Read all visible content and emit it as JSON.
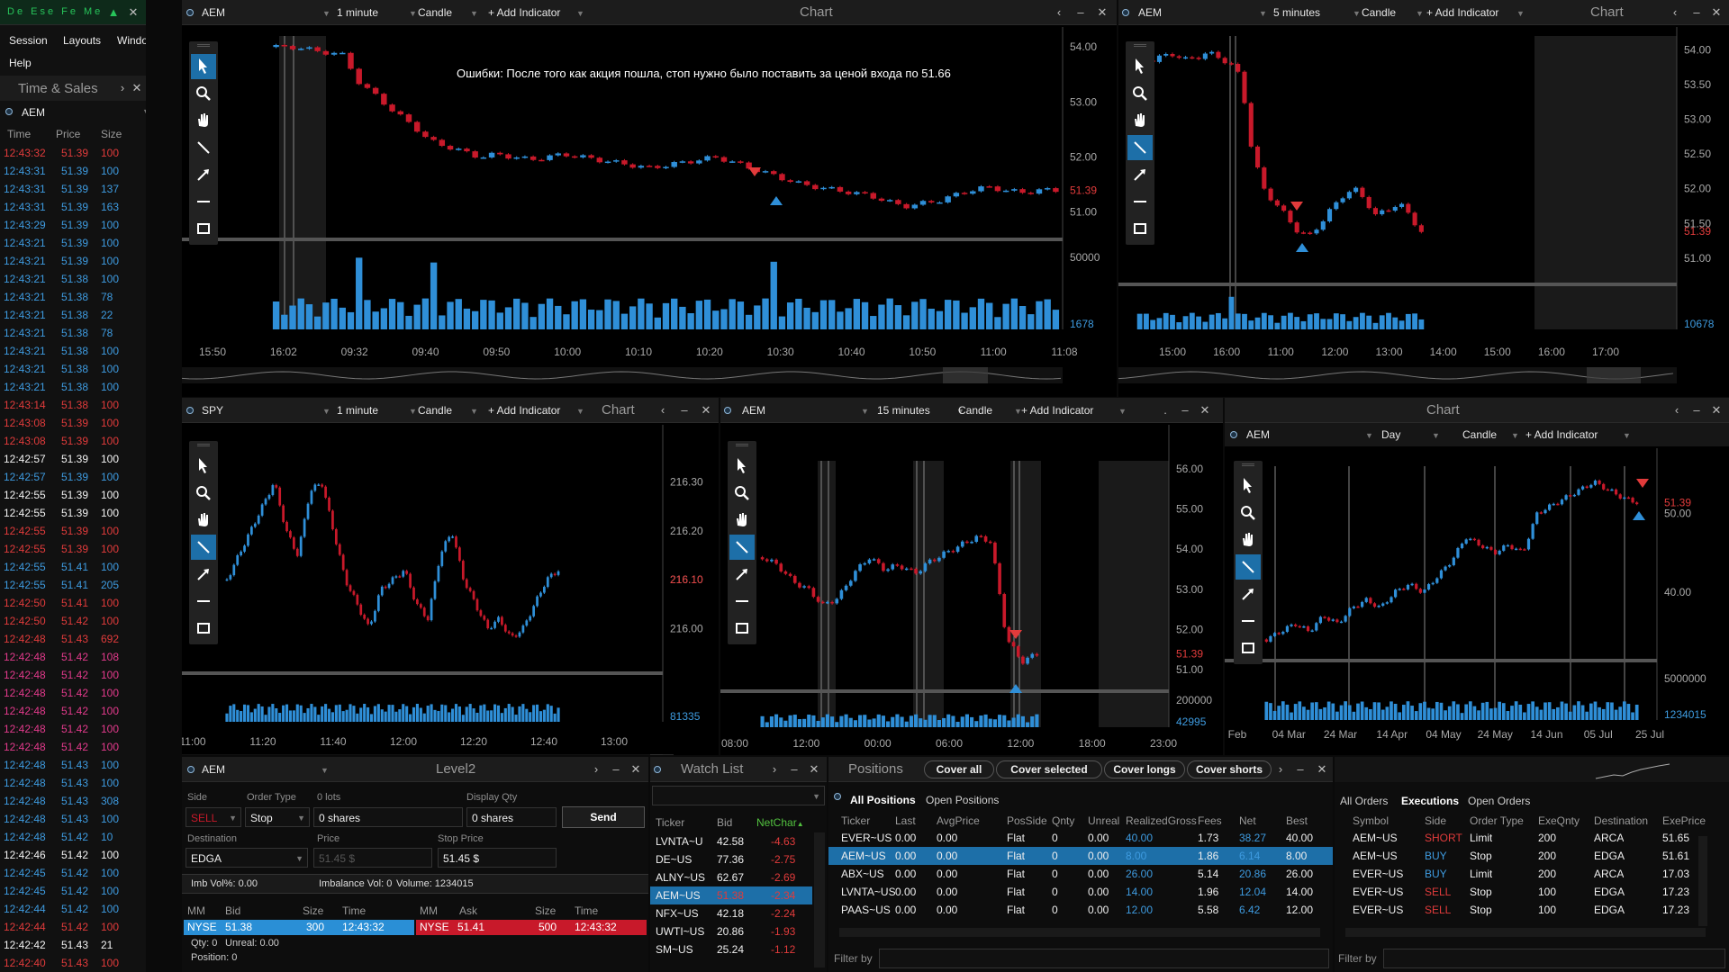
{
  "app": {
    "logo": "De Ese Fe Me"
  },
  "menu": {
    "session": "Session",
    "layouts": "Layouts",
    "windows": "Windows",
    "help": "Help"
  },
  "colors": {
    "up": "#2f8fd8",
    "down": "#c8192a",
    "accent": "#1d6fa8",
    "panel": "#000000",
    "bar": "#1c1c1c"
  },
  "icons": {
    "pointer": "pointer-icon",
    "zoom": "magnifier-icon",
    "pan": "hand-icon",
    "line": "line-tool-icon",
    "arrow": "arrow-tool-icon",
    "hline": "horizontal-line-icon",
    "rect": "rectangle-icon"
  },
  "ts": {
    "title": "Time & Sales",
    "symbol": "AEM",
    "headers": [
      "Time",
      "Price",
      "Size"
    ],
    "rows": [
      [
        "12:43:32",
        "51.39",
        "100",
        "r"
      ],
      [
        "12:43:31",
        "51.39",
        "100",
        "b"
      ],
      [
        "12:43:31",
        "51.39",
        "137",
        "b"
      ],
      [
        "12:43:31",
        "51.39",
        "163",
        "b"
      ],
      [
        "12:43:29",
        "51.39",
        "100",
        "b"
      ],
      [
        "12:43:21",
        "51.39",
        "100",
        "b"
      ],
      [
        "12:43:21",
        "51.39",
        "100",
        "b"
      ],
      [
        "12:43:21",
        "51.38",
        "100",
        "b"
      ],
      [
        "12:43:21",
        "51.38",
        "78",
        "b"
      ],
      [
        "12:43:21",
        "51.38",
        "22",
        "b"
      ],
      [
        "12:43:21",
        "51.38",
        "78",
        "b"
      ],
      [
        "12:43:21",
        "51.38",
        "100",
        "b"
      ],
      [
        "12:43:21",
        "51.38",
        "100",
        "b"
      ],
      [
        "12:43:21",
        "51.38",
        "100",
        "b"
      ],
      [
        "12:43:14",
        "51.38",
        "100",
        "r"
      ],
      [
        "12:43:08",
        "51.39",
        "100",
        "r"
      ],
      [
        "12:43:08",
        "51.39",
        "100",
        "r"
      ],
      [
        "12:42:57",
        "51.39",
        "100",
        "w"
      ],
      [
        "12:42:57",
        "51.39",
        "100",
        "b"
      ],
      [
        "12:42:55",
        "51.39",
        "100",
        "w"
      ],
      [
        "12:42:55",
        "51.39",
        "100",
        "w"
      ],
      [
        "12:42:55",
        "51.39",
        "100",
        "r"
      ],
      [
        "12:42:55",
        "51.39",
        "100",
        "r"
      ],
      [
        "12:42:55",
        "51.41",
        "100",
        "b"
      ],
      [
        "12:42:55",
        "51.41",
        "205",
        "b"
      ],
      [
        "12:42:50",
        "51.41",
        "100",
        "r"
      ],
      [
        "12:42:50",
        "51.42",
        "100",
        "r"
      ],
      [
        "12:42:48",
        "51.43",
        "692",
        "r"
      ],
      [
        "12:42:48",
        "51.42",
        "108",
        "p"
      ],
      [
        "12:42:48",
        "51.42",
        "100",
        "p"
      ],
      [
        "12:42:48",
        "51.42",
        "100",
        "p"
      ],
      [
        "12:42:48",
        "51.42",
        "100",
        "p"
      ],
      [
        "12:42:48",
        "51.42",
        "100",
        "p"
      ],
      [
        "12:42:48",
        "51.42",
        "100",
        "p"
      ],
      [
        "12:42:48",
        "51.43",
        "100",
        "b"
      ],
      [
        "12:42:48",
        "51.43",
        "100",
        "b"
      ],
      [
        "12:42:48",
        "51.43",
        "308",
        "b"
      ],
      [
        "12:42:48",
        "51.43",
        "100",
        "b"
      ],
      [
        "12:42:48",
        "51.42",
        "10",
        "b"
      ],
      [
        "12:42:46",
        "51.42",
        "100",
        "w"
      ],
      [
        "12:42:45",
        "51.42",
        "100",
        "b"
      ],
      [
        "12:42:45",
        "51.42",
        "100",
        "b"
      ],
      [
        "12:42:44",
        "51.42",
        "100",
        "b"
      ],
      [
        "12:42:44",
        "51.42",
        "100",
        "r"
      ],
      [
        "12:42:42",
        "51.43",
        "21",
        "w"
      ],
      [
        "12:42:40",
        "51.43",
        "100",
        "r"
      ]
    ]
  },
  "chart1": {
    "symbol": "AEM",
    "interval": "1 minute",
    "type": "Candle",
    "add": "+ Add Indicator",
    "title": "Chart",
    "annotation": "Ошибки: После того как акция пошла, стоп нужно было поставить за ценой входа по 51.66",
    "yticks": [
      "54.00",
      "53.00",
      "52.00",
      "51.00"
    ],
    "last": "51.39",
    "vol": "50000",
    "vol_last": "1678",
    "xticks": [
      "15:50",
      "16:02",
      "09:32",
      "09:40",
      "09:50",
      "10:00",
      "10:10",
      "10:20",
      "10:30",
      "10:40",
      "10:50",
      "11:00",
      "11:08"
    ],
    "chart_data": {
      "type": "candlestick",
      "price_range": [
        50.6,
        54.2
      ],
      "closes": [
        54.0,
        54.0,
        53.95,
        53.9,
        53.85,
        53.3,
        53.1,
        52.8,
        52.6,
        52.3,
        52.2,
        52.1,
        52.0,
        52.05,
        52.0,
        51.95,
        52.0,
        52.05,
        52.0,
        51.95,
        51.9,
        51.85,
        51.8,
        51.85,
        51.9,
        51.95,
        52.0,
        51.9,
        51.8,
        51.7,
        51.6,
        51.5,
        51.45,
        51.4,
        51.35,
        51.3,
        51.2,
        51.1,
        51.15,
        51.2,
        51.3,
        51.4,
        51.45,
        51.4,
        51.35,
        51.4,
        51.39
      ]
    }
  },
  "chart2": {
    "symbol": "AEM",
    "interval": "5 minutes",
    "type": "Candle",
    "add": "+ Add Indicator",
    "title": "Chart",
    "yticks": [
      "54.00",
      "53.50",
      "53.00",
      "52.50",
      "52.00",
      "51.50",
      "51.00"
    ],
    "last": "51.39",
    "vol_last": "10678",
    "xticks": [
      "15:00",
      "16:00",
      "11:00",
      "12:00",
      "13:00",
      "14:00",
      "15:00",
      "16:00",
      "17:00"
    ],
    "chart_data": {
      "type": "candlestick",
      "price_range": [
        50.7,
        54.2
      ],
      "closes": [
        53.9,
        53.85,
        53.9,
        53.95,
        53.85,
        53.9,
        53.95,
        53.9,
        53.8,
        53.6,
        52.5,
        52.0,
        51.8,
        51.6,
        51.4,
        51.3,
        51.5,
        51.7,
        51.9,
        52.0,
        51.85,
        51.6,
        51.7,
        51.8,
        51.6,
        51.39
      ]
    }
  },
  "chart3": {
    "symbol": "SPY",
    "interval": "1 minute",
    "type": "Candle",
    "add": "+ Add Indicator",
    "title": "Chart",
    "yticks": [
      "216.30",
      "216.20",
      "216.10",
      "216.00"
    ],
    "last": "216.10",
    "vol_last": "81335",
    "xticks": [
      "11:00",
      "11:20",
      "11:40",
      "12:00",
      "12:20",
      "12:40",
      "13:00"
    ],
    "chart_data": {
      "type": "candlestick",
      "price_range": [
        215.92,
        216.38
      ],
      "closes": [
        216.1,
        216.15,
        216.2,
        216.25,
        216.3,
        216.2,
        216.15,
        216.28,
        216.3,
        216.2,
        216.1,
        216.05,
        216.0,
        216.08,
        216.1,
        216.12,
        216.05,
        216.02,
        216.15,
        216.2,
        216.1,
        216.05,
        216.0,
        216.02,
        215.98,
        216.0,
        216.05,
        216.1,
        216.12
      ]
    }
  },
  "chart4": {
    "symbol": "AEM",
    "interval": "15 minutes",
    "type": "Candle",
    "add": "+ Add Indicator",
    "yticks": [
      "56.00",
      "55.00",
      "54.00",
      "53.00",
      "52.00",
      "51.00"
    ],
    "last": "51.39",
    "vol": "200000",
    "vol_last": "42995",
    "xticks": [
      "08:00",
      "12:00",
      "00:00",
      "06:00",
      "12:00",
      "18:00",
      "23:00"
    ],
    "chart_data": {
      "type": "candlestick",
      "price_range": [
        50.6,
        56.2
      ],
      "closes": [
        53.8,
        53.6,
        53.2,
        53.0,
        52.6,
        52.8,
        53.4,
        53.8,
        53.5,
        53.6,
        53.4,
        53.7,
        53.9,
        54.1,
        54.3,
        54.2,
        51.8,
        51.2,
        51.39
      ]
    }
  },
  "chart5": {
    "symbol": "AEM",
    "interval": "Day",
    "type": "Candle",
    "add": "+ Add Indicator",
    "title": "Chart",
    "yticks": [
      "50.00",
      "40.00"
    ],
    "last": "51.39",
    "vol": "5000000",
    "vol_last": "1234015",
    "xticks": [
      "Feb",
      "04 Mar",
      "24 Mar",
      "14 Apr",
      "04 May",
      "24 May",
      "14 Jun",
      "05 Jul",
      "25 Jul"
    ],
    "chart_data": {
      "type": "candlestick",
      "price_range": [
        32,
        56
      ],
      "closes": [
        34,
        35,
        36,
        35,
        37,
        36,
        38,
        39,
        38,
        40,
        41,
        40,
        42,
        44,
        47,
        46,
        45,
        46,
        45,
        50,
        51,
        52,
        53,
        54,
        53,
        52,
        51.39
      ]
    }
  },
  "level2": {
    "symbol": "AEM",
    "title": "Level2",
    "side_lbl": "Side",
    "ot_lbl": "Order Type",
    "lots_lbl": "0 lots",
    "dq_lbl": "Display Qty",
    "side": "SELL",
    "ot": "Stop",
    "shares": "0 shares",
    "dq": "0 shares",
    "send": "Send",
    "dest_lbl": "Destination",
    "price_lbl": "Price",
    "stop_lbl": "Stop Price",
    "dest": "EDGA",
    "price": "51.45 $",
    "stop": "51.45 $",
    "imb_vol": "Imb Vol%: 0.00",
    "imb": "Imbalance Vol: 0",
    "volume": "Volume: 1234015",
    "h_mm": "MM",
    "h_bid": "Bid",
    "h_size": "Size",
    "h_time": "Time",
    "h_mm2": "MM",
    "h_ask": "Ask",
    "h_size2": "Size",
    "h_time2": "Time",
    "bid_mm": "NYSE",
    "bid": "51.38",
    "bid_size": "300",
    "bid_time": "12:43:32",
    "ask_mm": "NYSE",
    "ask": "51.41",
    "ask_size": "500",
    "ask_time": "12:43:32",
    "qty": "Qty: 0",
    "unreal": "Unreal: 0.00",
    "position": "Position: 0"
  },
  "watch": {
    "title": "Watch List",
    "headers": [
      "Ticker",
      "Bid",
      "NetChar"
    ],
    "sort_arrow": "▲",
    "rows": [
      [
        "LVNTA~U",
        "42.58",
        "-4.63"
      ],
      [
        "DE~US",
        "77.36",
        "-2.75"
      ],
      [
        "ALNY~US",
        "62.67",
        "-2.69"
      ],
      [
        "AEM~US",
        "51.38",
        "-2.34"
      ],
      [
        "NFX~US",
        "42.18",
        "-2.24"
      ],
      [
        "UWTI~US",
        "20.86",
        "-1.93"
      ],
      [
        "SM~US",
        "25.24",
        "-1.12"
      ]
    ]
  },
  "positions": {
    "title": "Positions",
    "b1": "Cover all",
    "b2": "Cover selected",
    "b3": "Cover longs",
    "b4": "Cover shorts",
    "tab1": "All Positions",
    "tab2": "Open Positions",
    "headers": [
      "Ticker",
      "Last",
      "AvgPrice",
      "PosSide",
      "Qnty",
      "Unreal",
      "RealizedGross",
      "Fees",
      "Net",
      "Best"
    ],
    "rows": [
      [
        "EVER~US",
        "0.00",
        "0.00",
        "Flat",
        "0",
        "0.00",
        "40.00",
        "1.73",
        "38.27",
        "40.00"
      ],
      [
        "AEM~US",
        "0.00",
        "0.00",
        "Flat",
        "0",
        "0.00",
        "8.00",
        "1.86",
        "6.14",
        "8.00"
      ],
      [
        "ABX~US",
        "0.00",
        "0.00",
        "Flat",
        "0",
        "0.00",
        "26.00",
        "5.14",
        "20.86",
        "26.00"
      ],
      [
        "LVNTA~US",
        "0.00",
        "0.00",
        "Flat",
        "0",
        "0.00",
        "14.00",
        "1.96",
        "12.04",
        "14.00"
      ],
      [
        "PAAS~US",
        "0.00",
        "0.00",
        "Flat",
        "0",
        "0.00",
        "12.00",
        "5.58",
        "6.42",
        "12.00"
      ]
    ],
    "filter": "Filter by"
  },
  "orders": {
    "tab1": "All Orders",
    "tab2": "Executions",
    "tab3": "Open Orders",
    "headers": [
      "Symbol",
      "Side",
      "Order Type",
      "ExeQnty",
      "Destination",
      "ExePrice"
    ],
    "rows": [
      [
        "AEM~US",
        "SHORT",
        "Limit",
        "200",
        "ARCA",
        "51.65"
      ],
      [
        "AEM~US",
        "BUY",
        "Stop",
        "200",
        "EDGA",
        "51.61"
      ],
      [
        "EVER~US",
        "BUY",
        "Limit",
        "200",
        "ARCA",
        "17.03"
      ],
      [
        "EVER~US",
        "SELL",
        "Stop",
        "100",
        "EDGA",
        "17.23"
      ],
      [
        "EVER~US",
        "SELL",
        "Stop",
        "100",
        "EDGA",
        "17.23"
      ]
    ],
    "filter": "Filter by"
  }
}
